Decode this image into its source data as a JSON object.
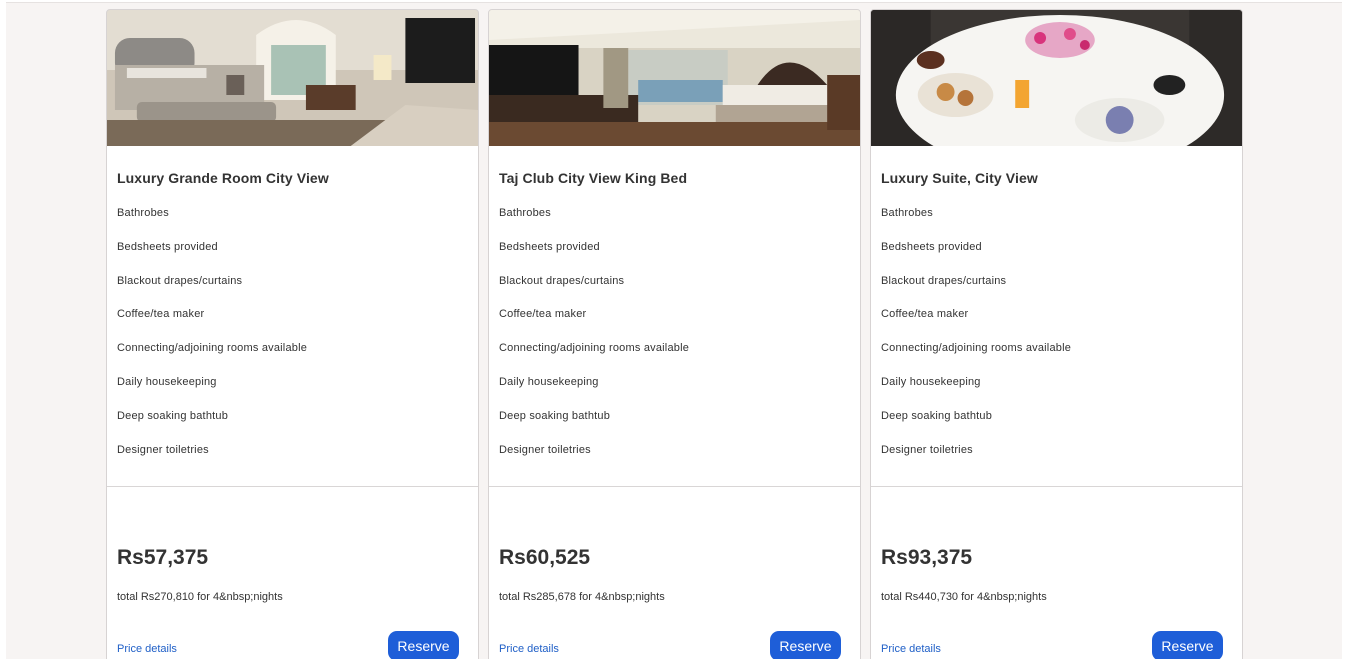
{
  "rooms": [
    {
      "image_desc": "bedroom-photo",
      "title": "Luxury Grande Room City View",
      "amenities": [
        "Bathrobes",
        "Bedsheets provided",
        "Blackout drapes/curtains",
        "Coffee/tea maker",
        "Connecting/adjoining rooms available",
        "Daily housekeeping",
        "Deep soaking bathtub",
        "Designer toiletries"
      ],
      "price": "Rs57,375",
      "total": "total Rs270,810 for 4&nbsp;nights",
      "price_details": "Price details",
      "reserve": "Reserve"
    },
    {
      "image_desc": "bedroom-photo",
      "title": "Taj Club City View King Bed",
      "amenities": [
        "Bathrobes",
        "Bedsheets provided",
        "Blackout drapes/curtains",
        "Coffee/tea maker",
        "Connecting/adjoining rooms available",
        "Daily housekeeping",
        "Deep soaking bathtub",
        "Designer toiletries"
      ],
      "price": "Rs60,525",
      "total": "total Rs285,678 for 4&nbsp;nights",
      "price_details": "Price details",
      "reserve": "Reserve"
    },
    {
      "image_desc": "breakfast-table-photo",
      "title": "Luxury Suite, City View",
      "amenities": [
        "Bathrobes",
        "Bedsheets provided",
        "Blackout drapes/curtains",
        "Coffee/tea maker",
        "Connecting/adjoining rooms available",
        "Daily housekeeping",
        "Deep soaking bathtub",
        "Designer toiletries"
      ],
      "price": "Rs93,375",
      "total": "total Rs440,730 for 4&nbsp;nights",
      "price_details": "Price details",
      "reserve": "Reserve"
    }
  ],
  "colors": {
    "accent": "#1e5ed8",
    "link": "#1f5fc7",
    "page_bg": "#f7f4f3"
  }
}
